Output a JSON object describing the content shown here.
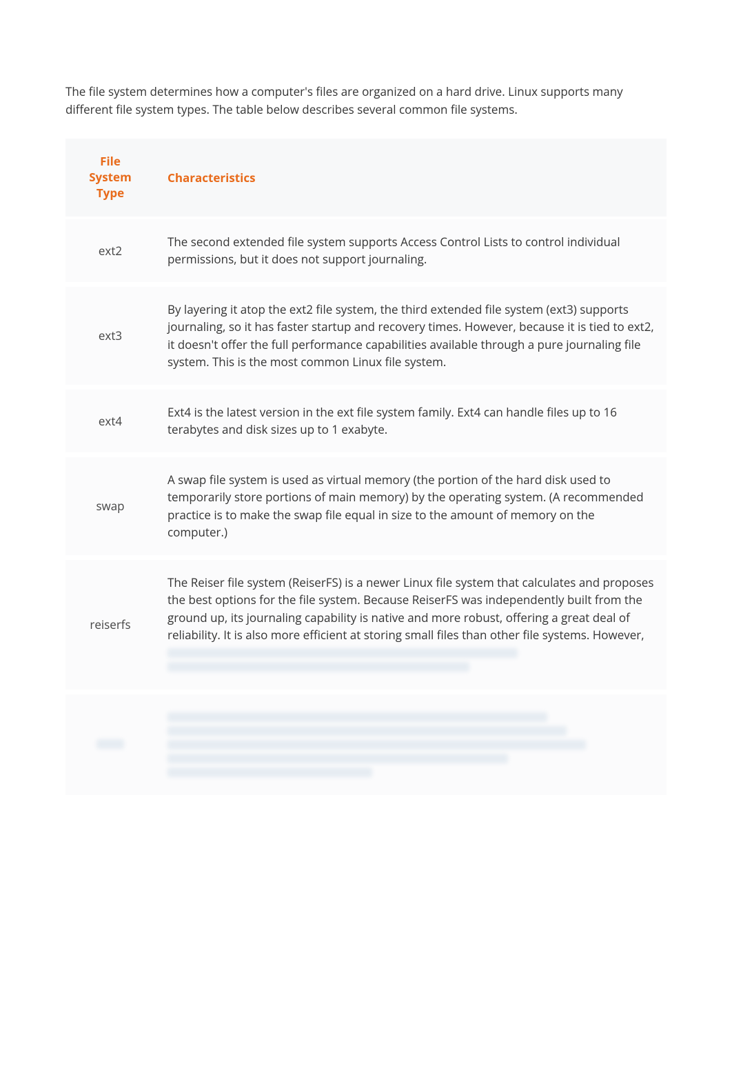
{
  "intro": "The file system determines how a computer's files are organized on a hard drive. Linux supports many different file system types. The table below describes several common file systems.",
  "table": {
    "headers": {
      "type": "File System Type",
      "characteristics": "Characteristics"
    },
    "rows": [
      {
        "type": "ext2",
        "desc": "The second extended file system supports Access Control Lists to control individual permissions, but it does not support journaling."
      },
      {
        "type": "ext3",
        "desc": "By layering it atop the ext2 file system, the third extended file system (ext3) supports journaling, so it has faster startup and recovery times. However, because it is tied to ext2, it doesn't offer the full performance capabilities available through a pure journaling file system. This is the most common Linux file system."
      },
      {
        "type": "ext4",
        "desc": "Ext4 is the latest version in the ext file system family. Ext4 can handle files up to 16 terabytes and disk sizes up to 1 exabyte."
      },
      {
        "type": "swap",
        "desc": "A swap file system is used as virtual memory (the portion of the hard disk used to temporarily store portions of main memory) by the operating system. (A recommended practice is to make the swap file equal in size to the amount of memory on the computer.)"
      },
      {
        "type": "reiserfs",
        "desc": "The Reiser file system (ReiserFS) is a newer Linux file system that calculates and proposes the best options for the file system. Because ReiserFS was independently built from the ground up, its journaling capability is native and more robust, offering a great deal of reliability. It is also more efficient at storing small files than other file systems. However,"
      }
    ]
  }
}
